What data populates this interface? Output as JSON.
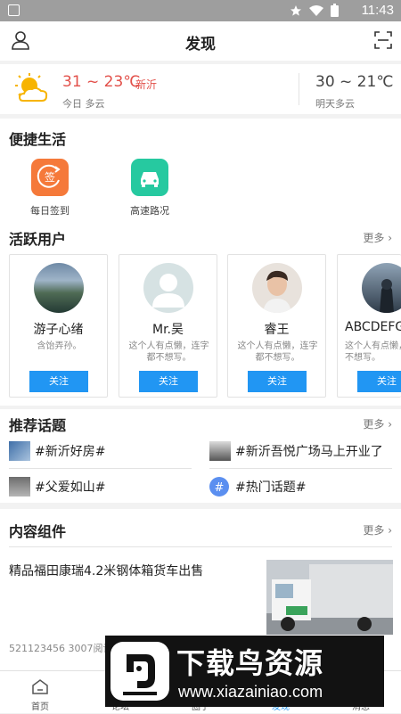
{
  "status_bar": {
    "time": "11:43"
  },
  "header": {
    "title": "发现"
  },
  "weather": {
    "today_temp": "31 ~ 23℃",
    "city": "新沂",
    "today_cond": "今日 多云",
    "tomorrow_temp": "30 ~ 21℃",
    "tomorrow_cond": "明天多云"
  },
  "quick_life": {
    "title": "便捷生活",
    "items": [
      {
        "label": "每日签到",
        "icon": "sign-in-icon",
        "icon_text": "签",
        "color": "#f5793a"
      },
      {
        "label": "高速路况",
        "icon": "car-icon",
        "color": "#26c9a0"
      }
    ]
  },
  "active_users": {
    "title": "活跃用户",
    "more": "更多",
    "users": [
      {
        "name": "游子心绪",
        "bio": "含饴弄孙。",
        "follow": "关注"
      },
      {
        "name": "Mr.吴",
        "bio": "这个人有点懒，连字都不想写。",
        "follow": "关注"
      },
      {
        "name": "睿王",
        "bio": "这个人有点懒，连字都不想写。",
        "follow": "关注"
      },
      {
        "name": "ABCDEFG",
        "bio": "这个人有点懒，连字都不想写。",
        "follow": "关注"
      }
    ]
  },
  "topics": {
    "title": "推荐话题",
    "more": "更多",
    "items": [
      "#新沂好房#",
      "#新沂吾悦广场马上开业了",
      "#父爱如山#",
      "#热门话题#"
    ]
  },
  "content": {
    "title": "内容组件",
    "more": "更多",
    "article": {
      "title": "精品福田康瑞4.2米钢体箱货车出售",
      "meta": "521123456   3007阅读"
    }
  },
  "tabbar": [
    {
      "label": "首页",
      "icon": "home-icon"
    },
    {
      "label": "论坛",
      "icon": "forum-icon"
    },
    {
      "label": "圈子",
      "icon": "circle-icon"
    },
    {
      "label": "发现",
      "icon": "discover-icon"
    },
    {
      "label": "消息",
      "icon": "message-icon"
    }
  ],
  "watermark": {
    "title": "下载鸟资源",
    "url": "www.xiazainiao.com"
  },
  "colors": {
    "accent": "#2196f3",
    "temp_red": "#e2504a"
  }
}
